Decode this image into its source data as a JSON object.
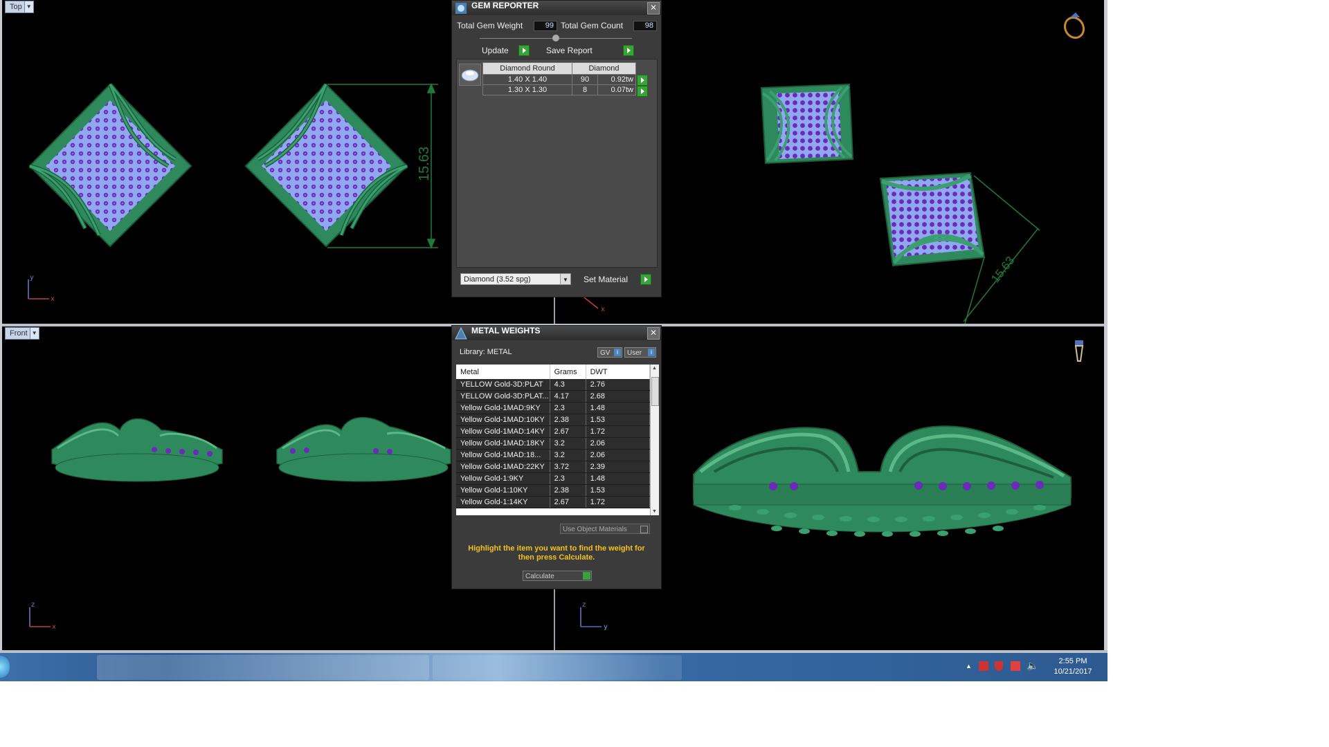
{
  "viewports": {
    "top_label": "Top",
    "front_label": "Front",
    "dimension_top": "15.63",
    "dimension_perspective": "15.63",
    "axis": {
      "x": "x",
      "y": "y",
      "z": "z"
    }
  },
  "gem_reporter": {
    "title": "GEM REPORTER",
    "total_weight_label": "Total Gem Weight",
    "total_weight_value": "99",
    "total_count_label": "Total Gem Count",
    "total_count_value": "98",
    "update_label": "Update",
    "save_report_label": "Save Report",
    "table_headers": [
      "Diamond Round",
      "Diamond"
    ],
    "rows": [
      {
        "size": "1.40 X 1.40",
        "count": "90",
        "weight": "0.92tw"
      },
      {
        "size": "1.30 X 1.30",
        "count": "8",
        "weight": "0.07tw"
      }
    ],
    "material_select": "Diamond    (3.52 spg)",
    "set_material_label": "Set Material"
  },
  "metal_weights": {
    "title": "METAL WEIGHTS",
    "library_label": "Library: METAL",
    "gv_label": "GV",
    "user_label": "User",
    "columns": [
      "Metal",
      "Grams",
      "DWT"
    ],
    "rows": [
      {
        "metal": "YELLOW Gold-3D:PLAT",
        "grams": "4.3",
        "dwt": "2.76"
      },
      {
        "metal": "YELLOW Gold-3D:PLAT...",
        "grams": "4.17",
        "dwt": "2.68"
      },
      {
        "metal": "Yellow Gold-1MAD:9KY",
        "grams": "2.3",
        "dwt": "1.48"
      },
      {
        "metal": "Yellow Gold-1MAD:10KY",
        "grams": "2.38",
        "dwt": "1.53"
      },
      {
        "metal": "Yellow Gold-1MAD:14KY",
        "grams": "2.67",
        "dwt": "1.72"
      },
      {
        "metal": "Yellow Gold-1MAD:18KY",
        "grams": "3.2",
        "dwt": "2.06"
      },
      {
        "metal": "Yellow Gold-1MAD:18...",
        "grams": "3.2",
        "dwt": "2.06"
      },
      {
        "metal": "Yellow Gold-1MAD:22KY",
        "grams": "3.72",
        "dwt": "2.39"
      },
      {
        "metal": "Yellow Gold-1:9KY",
        "grams": "2.3",
        "dwt": "1.48"
      },
      {
        "metal": "Yellow Gold-1:10KY",
        "grams": "2.38",
        "dwt": "1.53"
      },
      {
        "metal": "Yellow Gold-1:14KY",
        "grams": "2.67",
        "dwt": "1.72"
      }
    ],
    "use_object_materials": "Use Object Materials",
    "instruction": "Highlight the item you want to find the weight for then press Calculate.",
    "calculate_label": "Calculate"
  },
  "taskbar": {
    "time": "2:55 PM",
    "date": "10/21/2017"
  },
  "colors": {
    "model_green": "#2e8a5c",
    "gem_purple": "#6a2bb8",
    "pave_blue": "#8fa8f0",
    "dimension_green": "#1f7a3a",
    "button_green": "#3aa23a",
    "instruction_yellow": "#f2c21b"
  }
}
